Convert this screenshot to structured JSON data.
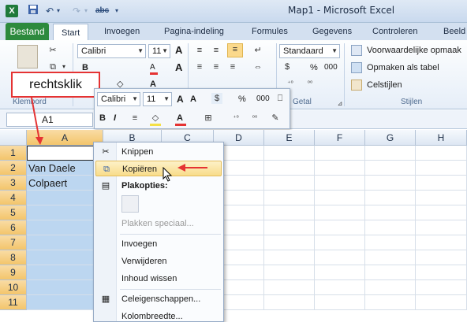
{
  "titlebar": {
    "title": "Map1  -  Microsoft Excel",
    "icon": "X",
    "cut_glyph": "abc"
  },
  "tabs": [
    "Bestand",
    "Start",
    "Invoegen",
    "Pagina-indeling",
    "Formules",
    "Gegevens",
    "Controleren",
    "Beeld"
  ],
  "ribbon": {
    "font_name": "Calibri",
    "font_size": "11",
    "number_format": "Standaard",
    "styles": [
      "Voorwaardelijke opmaak",
      "Opmaken als tabel",
      "Celstijlen"
    ],
    "group_labels": {
      "clipboard": "Klembord",
      "number": "Getal",
      "styles": "Stijlen"
    },
    "percent": "%",
    "thousands": "000"
  },
  "callout": {
    "text": "rechtsklik",
    "color": "#e53333"
  },
  "namebox": {
    "value": "A1"
  },
  "minitoolbar": {
    "font": "Calibri",
    "size": "11",
    "percent": "%",
    "thousands": "000"
  },
  "columns": [
    "A",
    "B",
    "C",
    "D",
    "E",
    "F",
    "G",
    "H"
  ],
  "rows": [
    "1",
    "2",
    "3",
    "4",
    "5",
    "6",
    "7",
    "8",
    "9",
    "10",
    "11"
  ],
  "cells": {
    "A2": "Van Daele",
    "A3": "Colpaert"
  },
  "context_menu": {
    "cut": "Knippen",
    "copy": "Kopiëren",
    "paste_options": "Plakopties:",
    "paste_special": "Plakken speciaal...",
    "insert": "Invoegen",
    "delete": "Verwijderen",
    "clear": "Inhoud wissen",
    "format_cells": "Celeigenschappen...",
    "col_width": "Kolombreedte..."
  },
  "colors": {
    "accent_green": "#2d8a3d",
    "selection": "#bcd6f0",
    "arrow_red": "#e53333"
  }
}
